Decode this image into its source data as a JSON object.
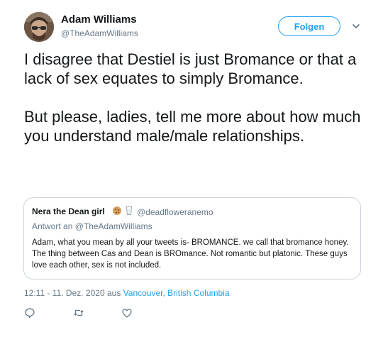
{
  "author": {
    "name": "Adam Williams",
    "handle": "@TheAdamWilliams"
  },
  "follow_label": "Folgen",
  "tweet_text": "I disagree that Destiel is just Bromance or that a lack of sex equates to simply Bromance.\n\nBut please, ladies, tell me more about how much you understand male/male relationships.",
  "quoted": {
    "name": "Nera the Dean girl",
    "emojis": [
      "cookie-icon",
      "milk-glass-icon"
    ],
    "handle": "@deadfloweranemo",
    "reply_to": "Antwort an @TheAdamWilliams",
    "text": "Adam, what you mean by all your tweets is- BROMANCE. we call that bromance honey. The thing between Cas and Dean is BROmance. Not romantic but platonic. These guys love each other, sex is not included."
  },
  "meta": {
    "time_prefix": "12:11 - 11. Dez. 2020 aus ",
    "location": "Vancouver, British Columbia"
  },
  "actions": [
    "reply-icon",
    "retweet-icon",
    "like-icon"
  ],
  "colors": {
    "accent": "#1da1f2",
    "secondary_text": "#657786",
    "border": "#ccd6dd"
  }
}
